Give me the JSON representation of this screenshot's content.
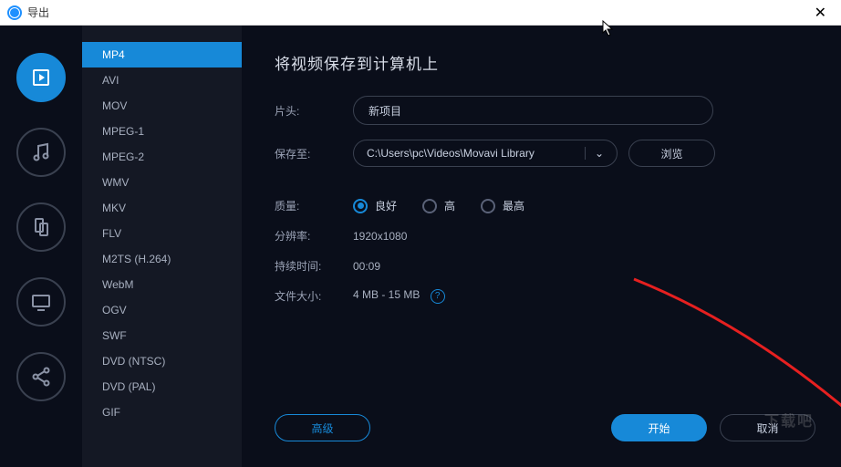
{
  "titlebar": {
    "title": "导出"
  },
  "rail": {
    "items": [
      "video",
      "audio",
      "mobile",
      "tv",
      "share"
    ]
  },
  "formats": {
    "items": [
      "MP4",
      "AVI",
      "MOV",
      "MPEG-1",
      "MPEG-2",
      "WMV",
      "MKV",
      "FLV",
      "M2TS (H.264)",
      "WebM",
      "OGV",
      "SWF",
      "DVD (NTSC)",
      "DVD (PAL)",
      "GIF"
    ],
    "selected": 0
  },
  "content": {
    "title": "将视频保存到计算机上",
    "name_label": "片头:",
    "name_value": "新项目",
    "saveto_label": "保存至:",
    "saveto_path": "C:\\Users\\pc\\Videos\\Movavi Library",
    "browse_label": "浏览",
    "quality_label": "质量:",
    "quality_options": [
      "良好",
      "高",
      "最高"
    ],
    "quality_selected": 0,
    "resolution_label": "分辨率:",
    "resolution_value": "1920x1080",
    "duration_label": "持续时间:",
    "duration_value": "00:09",
    "filesize_label": "文件大小:",
    "filesize_value": "4 MB - 15 MB"
  },
  "footer": {
    "advanced": "高级",
    "start": "开始",
    "cancel": "取消"
  },
  "watermark": "下载吧"
}
